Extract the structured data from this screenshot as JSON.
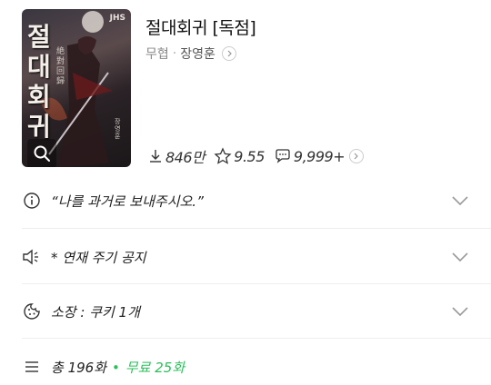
{
  "cover": {
    "title_chars": [
      "절",
      "대",
      "회",
      "귀"
    ],
    "hanja": "絶對回歸",
    "watermark": "JHS",
    "author_vertical": "장영훈",
    "search_icon": "search-icon"
  },
  "work": {
    "title": "절대회귀 [독점]",
    "genre": "무협",
    "separator": "·",
    "author": "장영훈"
  },
  "stats": {
    "downloads": "846만",
    "rating": "9.55",
    "comments": "9,999+"
  },
  "rows": {
    "tagline": "“나를 과거로 보내주시오.”",
    "notice": "* 연재 주기 공지",
    "ownership": "소장 : 쿠키 1개",
    "total": "총 196화",
    "total_separator": "•",
    "free": "무료 25화"
  },
  "colors": {
    "accent_green": "#2bbf5a",
    "divider": "#eeeeee",
    "text": "#222222"
  }
}
